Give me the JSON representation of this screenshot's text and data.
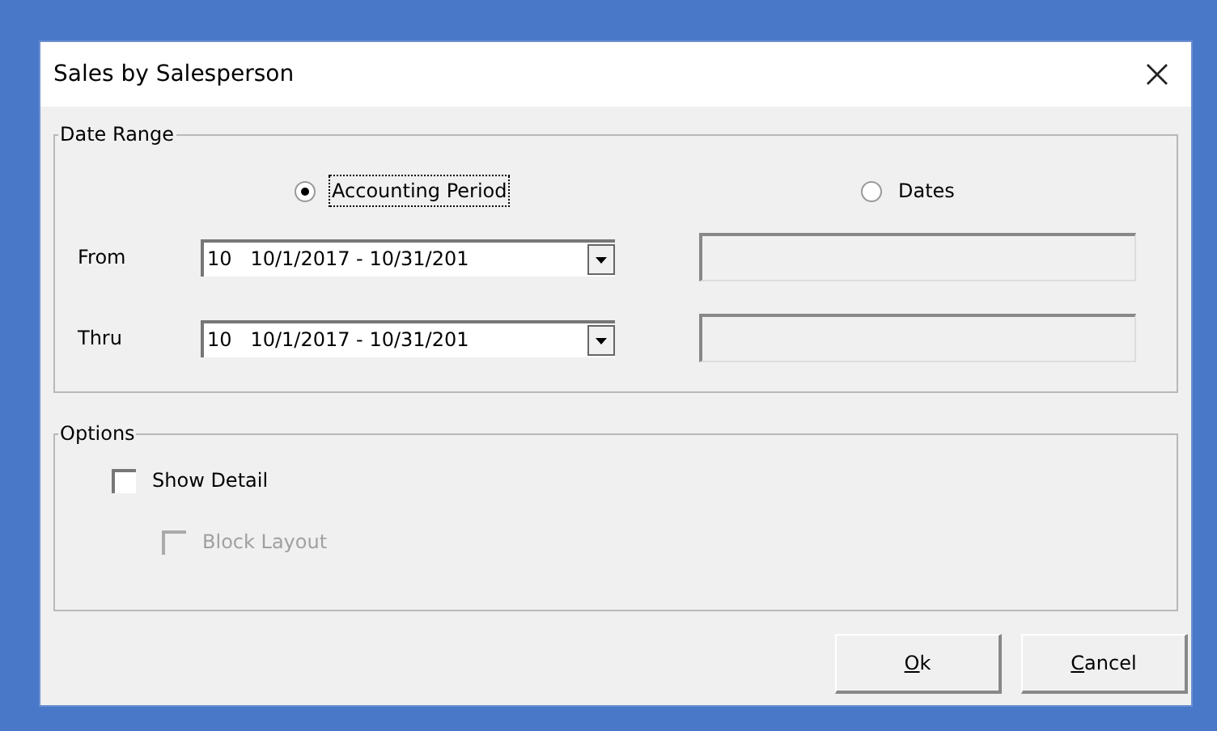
{
  "window": {
    "title": "Sales by Salesperson"
  },
  "date_range": {
    "title": "Date Range",
    "modes": [
      {
        "label": "Accounting Period",
        "selected": true,
        "focused": true
      },
      {
        "label": "Dates",
        "selected": false,
        "focused": false
      }
    ],
    "rows": [
      {
        "label": "From",
        "period": "10   10/1/2017 - 10/31/201",
        "date_disabled": true
      },
      {
        "label": "Thru",
        "period": "10   10/1/2017 - 10/31/201",
        "date_disabled": true
      }
    ]
  },
  "options": {
    "title": "Options",
    "items": [
      {
        "label": "Show Detail",
        "checked": false,
        "disabled": false,
        "nested": false
      },
      {
        "label": "Block Layout",
        "checked": false,
        "disabled": true,
        "nested": true
      }
    ]
  },
  "buttons": [
    "Ok",
    "Cancel"
  ]
}
